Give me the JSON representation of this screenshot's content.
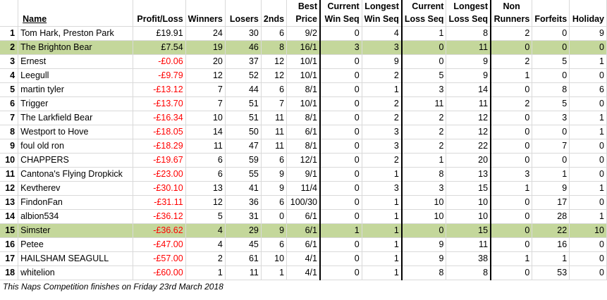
{
  "headers": {
    "row1": {
      "best": "Best",
      "current_win": "Current",
      "longest_win": "Longest",
      "current_loss": "Current",
      "longest_loss": "Longest",
      "non": "Non"
    },
    "row2": {
      "name": "Name",
      "profit": "Profit/Loss",
      "winners": "Winners",
      "losers": "Losers",
      "seconds": "2nds",
      "price": "Price",
      "win_seq": "Win Seq",
      "longest_win_seq": "Win Seq",
      "loss_seq": "Loss Seq",
      "longest_loss_seq": "Loss Seq",
      "runners": "Runners",
      "forfeits": "Forfeits",
      "holiday": "Holiday"
    }
  },
  "rows": [
    {
      "rank": "1",
      "name": "Tom Hark, Preston Park",
      "profit": "£19.91",
      "winners": "24",
      "losers": "30",
      "seconds": "6",
      "price": "9/2",
      "cws": "0",
      "lws": "4",
      "cls": "1",
      "lls": "8",
      "nr": "2",
      "forfeits": "0",
      "holiday": "9"
    },
    {
      "rank": "2",
      "name": "The Brighton Bear",
      "profit": "£7.54",
      "winners": "19",
      "losers": "46",
      "seconds": "8",
      "price": "16/1",
      "cws": "3",
      "lws": "3",
      "cls": "0",
      "lls": "11",
      "nr": "0",
      "forfeits": "0",
      "holiday": "0"
    },
    {
      "rank": "3",
      "name": "Ernest",
      "profit": "-£0.06",
      "winners": "20",
      "losers": "37",
      "seconds": "12",
      "price": "10/1",
      "cws": "0",
      "lws": "9",
      "cls": "0",
      "lls": "9",
      "nr": "2",
      "forfeits": "5",
      "holiday": "1"
    },
    {
      "rank": "4",
      "name": "Leegull",
      "profit": "-£9.79",
      "winners": "12",
      "losers": "52",
      "seconds": "12",
      "price": "10/1",
      "cws": "0",
      "lws": "2",
      "cls": "5",
      "lls": "9",
      "nr": "1",
      "forfeits": "0",
      "holiday": "0"
    },
    {
      "rank": "5",
      "name": "martin tyler",
      "profit": "-£13.12",
      "winners": "7",
      "losers": "44",
      "seconds": "6",
      "price": "8/1",
      "cws": "0",
      "lws": "1",
      "cls": "3",
      "lls": "14",
      "nr": "0",
      "forfeits": "8",
      "holiday": "6"
    },
    {
      "rank": "6",
      "name": "Trigger",
      "profit": "-£13.70",
      "winners": "7",
      "losers": "51",
      "seconds": "7",
      "price": "10/1",
      "cws": "0",
      "lws": "2",
      "cls": "11",
      "lls": "11",
      "nr": "2",
      "forfeits": "5",
      "holiday": "0"
    },
    {
      "rank": "7",
      "name": "The Larkfield Bear",
      "profit": "-£16.34",
      "winners": "10",
      "losers": "51",
      "seconds": "11",
      "price": "8/1",
      "cws": "0",
      "lws": "2",
      "cls": "2",
      "lls": "12",
      "nr": "0",
      "forfeits": "3",
      "holiday": "1"
    },
    {
      "rank": "8",
      "name": "Westport to Hove",
      "profit": "-£18.05",
      "winners": "14",
      "losers": "50",
      "seconds": "11",
      "price": "6/1",
      "cws": "0",
      "lws": "3",
      "cls": "2",
      "lls": "12",
      "nr": "0",
      "forfeits": "0",
      "holiday": "1"
    },
    {
      "rank": "9",
      "name": "foul old ron",
      "profit": "-£18.29",
      "winners": "11",
      "losers": "47",
      "seconds": "11",
      "price": "8/1",
      "cws": "0",
      "lws": "3",
      "cls": "2",
      "lls": "22",
      "nr": "0",
      "forfeits": "7",
      "holiday": "0"
    },
    {
      "rank": "10",
      "name": "CHAPPERS",
      "profit": "-£19.67",
      "winners": "6",
      "losers": "59",
      "seconds": "6",
      "price": "12/1",
      "cws": "0",
      "lws": "2",
      "cls": "1",
      "lls": "20",
      "nr": "0",
      "forfeits": "0",
      "holiday": "0"
    },
    {
      "rank": "11",
      "name": "Cantona's Flying Dropkick",
      "profit": "-£23.00",
      "winners": "6",
      "losers": "55",
      "seconds": "9",
      "price": "9/1",
      "cws": "0",
      "lws": "1",
      "cls": "8",
      "lls": "13",
      "nr": "3",
      "forfeits": "1",
      "holiday": "0"
    },
    {
      "rank": "12",
      "name": "Kevtherev",
      "profit": "-£30.10",
      "winners": "13",
      "losers": "41",
      "seconds": "9",
      "price": "11/4",
      "cws": "0",
      "lws": "3",
      "cls": "3",
      "lls": "15",
      "nr": "1",
      "forfeits": "9",
      "holiday": "1"
    },
    {
      "rank": "13",
      "name": "FindonFan",
      "profit": "-£31.11",
      "winners": "12",
      "losers": "36",
      "seconds": "6",
      "price": "100/30",
      "cws": "0",
      "lws": "1",
      "cls": "10",
      "lls": "10",
      "nr": "0",
      "forfeits": "17",
      "holiday": "0"
    },
    {
      "rank": "14",
      "name": "albion534",
      "profit": "-£36.12",
      "winners": "5",
      "losers": "31",
      "seconds": "0",
      "price": "6/1",
      "cws": "0",
      "lws": "1",
      "cls": "10",
      "lls": "10",
      "nr": "0",
      "forfeits": "28",
      "holiday": "1"
    },
    {
      "rank": "15",
      "name": "Simster",
      "profit": "-£36.62",
      "winners": "4",
      "losers": "29",
      "seconds": "9",
      "price": "6/1",
      "cws": "1",
      "lws": "1",
      "cls": "0",
      "lls": "15",
      "nr": "0",
      "forfeits": "22",
      "holiday": "10"
    },
    {
      "rank": "16",
      "name": "Petee",
      "profit": "-£47.00",
      "winners": "4",
      "losers": "45",
      "seconds": "6",
      "price": "6/1",
      "cws": "0",
      "lws": "1",
      "cls": "9",
      "lls": "11",
      "nr": "0",
      "forfeits": "16",
      "holiday": "0"
    },
    {
      "rank": "17",
      "name": "HAILSHAM SEAGULL",
      "profit": "-£57.00",
      "winners": "2",
      "losers": "61",
      "seconds": "10",
      "price": "4/1",
      "cws": "0",
      "lws": "1",
      "cls": "9",
      "lls": "38",
      "nr": "1",
      "forfeits": "1",
      "holiday": "0"
    },
    {
      "rank": "18",
      "name": "whitelion",
      "profit": "-£60.00",
      "winners": "1",
      "losers": "11",
      "seconds": "1",
      "price": "4/1",
      "cws": "0",
      "lws": "1",
      "cls": "8",
      "lls": "8",
      "nr": "0",
      "forfeits": "53",
      "holiday": "0"
    }
  ],
  "highlighted_ranks": [
    "2",
    "15"
  ],
  "colors": {
    "highlight": "#c4d79b",
    "negative": "#ff0000",
    "grid": "#d9d9d9"
  },
  "footer": "This Naps Competition finishes on Friday 23rd March 2018"
}
